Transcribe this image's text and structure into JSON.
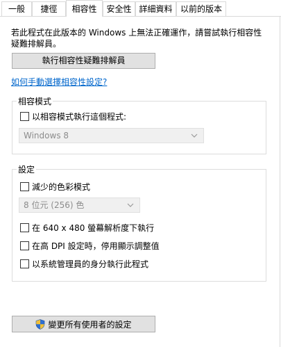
{
  "tabs": [
    "一般",
    "捷徑",
    "相容性",
    "安全性",
    "詳細資料",
    "以前的版本"
  ],
  "active_tab": "相容性",
  "intro_line1": "若此程式在此版本的 Windows 上無法正確運作，請嘗試執行相容性",
  "intro_line2": "疑難排解員。",
  "troubleshooter_button": "執行相容性疑難排解員",
  "manual_link": "如何手動選擇相容性設定?",
  "compat_group": {
    "title": "相容模式",
    "checkbox_label": "以相容模式執行這個程式:",
    "select_value": "Windows 8"
  },
  "settings_group": {
    "title": "設定",
    "reduced_color_label": "減少的色彩模式",
    "color_select_value": "8 位元 (256) 色",
    "res_640_label": "在 640 x 480 螢幕解析度下執行",
    "high_dpi_label": "在高 DPI 設定時，停用顯示調整值",
    "run_admin_label": "以系統管理員的身分執行此程式"
  },
  "change_all_users_button": "變更所有使用者的設定",
  "icons": {
    "chevron": "chevron-down-icon",
    "shield": "uac-shield-icon"
  },
  "colors": {
    "link": "#0066cc",
    "shield_blue": "#2e6fd1",
    "shield_yellow": "#f2c037"
  }
}
